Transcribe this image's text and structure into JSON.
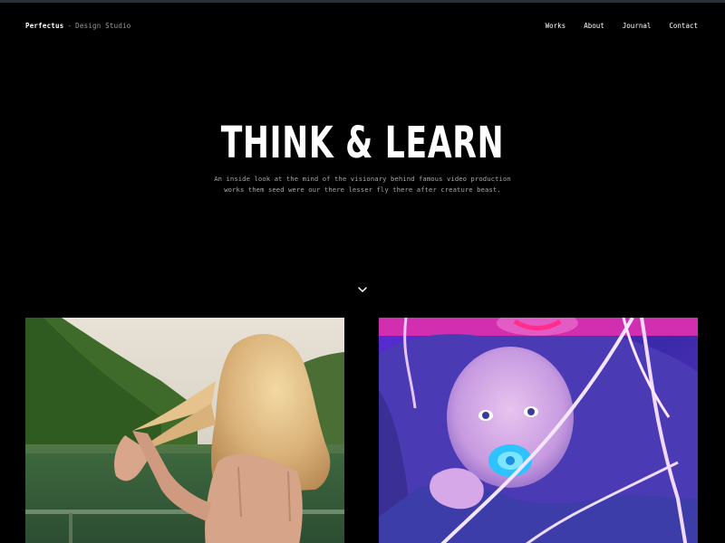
{
  "header": {
    "brand_name": "Perfectus",
    "brand_separator": "-",
    "brand_tagline": "Design Studio",
    "nav": [
      {
        "label": "Works"
      },
      {
        "label": "About"
      },
      {
        "label": "Journal"
      },
      {
        "label": "Contact"
      }
    ]
  },
  "hero": {
    "title": "THINK & LEARN",
    "subtitle": "An inside look at the mind of the visionary behind famous video production works them seed were our there lesser fly there after creature beast."
  },
  "icons": {
    "scroll_down": "chevron-down-icon"
  },
  "colors": {
    "background": "#000000",
    "text": "#ffffff",
    "muted_text": "#a8a8a8"
  },
  "gallery": [
    {
      "image": "woman-with-blonde-hair-by-lake"
    },
    {
      "image": "baby-with-pacifier-in-neon-light"
    }
  ]
}
